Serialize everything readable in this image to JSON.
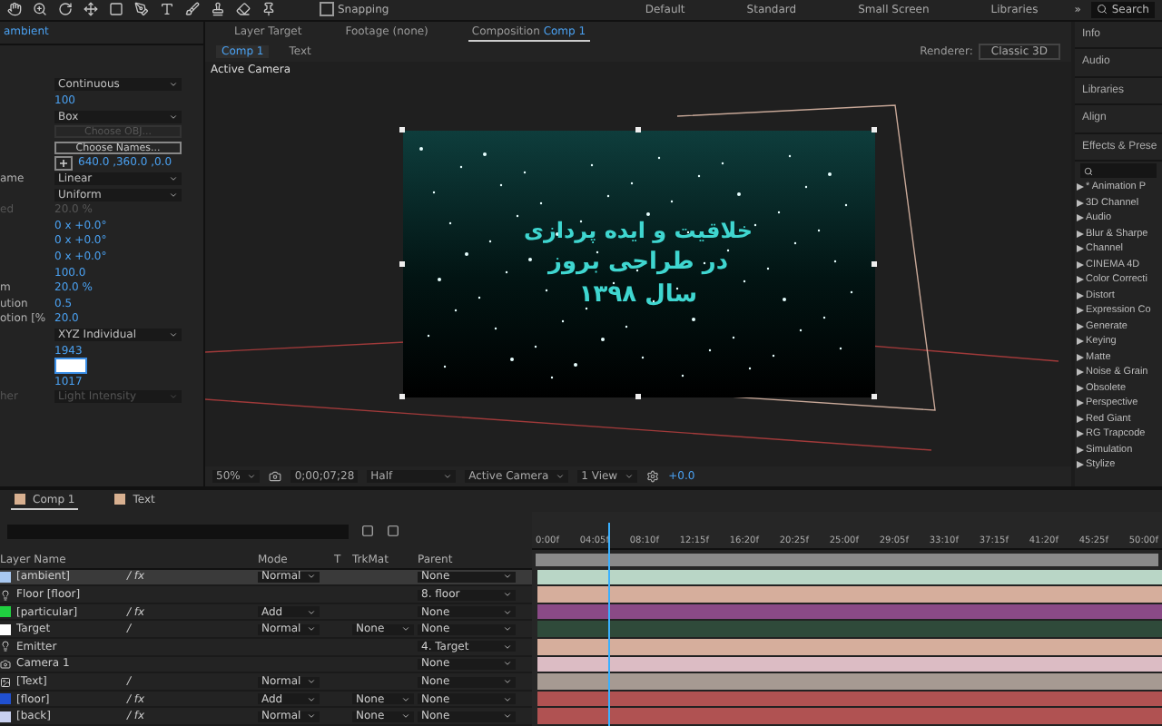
{
  "toolbar": {
    "snapping": {
      "label": "Snapping",
      "checked": false
    },
    "workspaces": [
      {
        "label": "Default",
        "selected": false
      },
      {
        "label": "Standard",
        "selected": false
      },
      {
        "label": "Small Screen",
        "selected": false
      },
      {
        "label": "Libraries",
        "selected": false
      }
    ],
    "more": "»",
    "search": {
      "placeholder": "Search"
    }
  },
  "effect_controls": {
    "tab": "ambient",
    "properties": [
      {
        "kind": "dropdown",
        "value": "Continuous",
        "disabled": false
      },
      {
        "kind": "number",
        "value": "100",
        "disabled": false
      },
      {
        "kind": "dropdown",
        "value": "Box",
        "disabled": false
      },
      {
        "kind": "button",
        "value": "Choose OBJ...",
        "disabled": true
      },
      {
        "kind": "button",
        "value": "Choose Names...",
        "disabled": false
      },
      {
        "kind": "point",
        "value": "640.0 ,360.0 ,0.0",
        "disabled": false
      },
      {
        "kind": "dropdown",
        "label": "ame",
        "value": "Linear",
        "disabled": false
      },
      {
        "kind": "dropdown",
        "value": "Uniform",
        "disabled": false
      },
      {
        "kind": "number",
        "label": "ed",
        "value": "20.0 %",
        "disabled": true
      },
      {
        "kind": "number",
        "value": "0 x +0.0°",
        "disabled": false
      },
      {
        "kind": "number",
        "value": "0 x +0.0°",
        "disabled": false
      },
      {
        "kind": "number",
        "value": "0 x +0.0°",
        "disabled": false
      },
      {
        "kind": "number",
        "value": "100.0",
        "disabled": false
      },
      {
        "kind": "number",
        "label": "m",
        "value": "20.0 %",
        "disabled": false
      },
      {
        "kind": "number",
        "label": "ution",
        "value": "0.5",
        "disabled": false
      },
      {
        "kind": "number",
        "label": "otion [%",
        "value": "20.0",
        "disabled": false
      },
      {
        "kind": "dropdown",
        "value": "XYZ Individual",
        "disabled": false
      },
      {
        "kind": "number",
        "value": "1943",
        "disabled": false
      },
      {
        "kind": "editing",
        "disabled": false
      },
      {
        "kind": "number",
        "value": "1017",
        "disabled": false
      },
      {
        "kind": "dropdown",
        "label": "her",
        "value": "Light Intensity",
        "disabled": true
      }
    ]
  },
  "viewer": {
    "tabs": [
      {
        "label": "Layer",
        "name": "Target",
        "selected": false
      },
      {
        "label": "Footage",
        "name": "(none)",
        "selected": false
      },
      {
        "label": "Composition",
        "name": "Comp 1",
        "selected": true
      }
    ],
    "subtabs": [
      {
        "label": "Comp 1",
        "selected": true
      },
      {
        "label": "Text",
        "selected": false
      }
    ],
    "renderer": {
      "label": "Renderer:",
      "value": "Classic 3D"
    },
    "view_label": "Active Camera",
    "comp_text": [
      "خلاقیت و ایده پردازی",
      "در طراحی بروز",
      "سال ۱۳۹۸"
    ],
    "bottom_bar": {
      "zoom": "50%",
      "timecode": "0;00;07;28",
      "resolution": "Half",
      "camera": "Active Camera",
      "layout": "1 View",
      "exposure": "+0.0"
    }
  },
  "right_panel": {
    "panels": [
      "Info",
      "Audio",
      "Libraries",
      "Align",
      "Effects & Prese"
    ],
    "effects": [
      "* Animation P",
      "3D Channel",
      "Audio",
      "Blur & Sharpe",
      "Channel",
      "CINEMA 4D",
      "Color Correcti",
      "Distort",
      "Expression Co",
      "Generate",
      "Keying",
      "Matte",
      "Noise & Grain",
      "Obsolete",
      "Perspective",
      "Red Giant",
      "RG Trapcode",
      "Simulation",
      "Stylize"
    ]
  },
  "timeline": {
    "tabs": [
      {
        "label": "Comp 1",
        "selected": true
      },
      {
        "label": "Text",
        "selected": false
      }
    ],
    "columns": {
      "name": "Layer Name",
      "mode": "Mode",
      "t": "T",
      "trkmat": "TrkMat",
      "parent": "Parent"
    },
    "ticks": [
      "0:00f",
      "04:05f",
      "08:10f",
      "12:15f",
      "16:20f",
      "20:25f",
      "25:00f",
      "29:05f",
      "33:10f",
      "37:15f",
      "41:20f",
      "45:25f",
      "50:00f"
    ],
    "playhead": {
      "level": 0.12
    },
    "bars": [
      {
        "color": "#b9d6c6"
      },
      {
        "color": "#d6ae9c"
      },
      {
        "color": "#8a4a86"
      },
      {
        "color": "#2f4a3a"
      },
      {
        "color": "#d6ae9c"
      },
      {
        "color": "#dcbcc4"
      },
      {
        "color": "#a69a92"
      },
      {
        "color": "#b05252"
      },
      {
        "color": "#b05252"
      }
    ],
    "layers": [
      {
        "kind": "solid",
        "color": "#a8c8f0",
        "name": "[ambient]",
        "switches": "/ fx",
        "mode": "Normal",
        "parent": "None",
        "selected": true
      },
      {
        "kind": "light",
        "name": "Floor [floor]",
        "parent": "8. floor",
        "selected": false
      },
      {
        "kind": "solid",
        "color": "#20d040",
        "name": "[particular]",
        "switches": "/ fx",
        "mode": "Add",
        "parent": "None",
        "selected": false
      },
      {
        "kind": "solid",
        "color": "#ffffff",
        "name": "Target",
        "switches": "/",
        "mode": "Normal",
        "trkmat": "None",
        "parent": "None",
        "selected": false
      },
      {
        "kind": "light",
        "name": "Emitter",
        "parent": "4. Target",
        "selected": false
      },
      {
        "kind": "camera",
        "name": "Camera 1",
        "parent": "None",
        "selected": false
      },
      {
        "kind": "footage",
        "name": "[Text]",
        "switches": "/",
        "mode": "Normal",
        "parent": "None",
        "selected": false
      },
      {
        "kind": "solid",
        "color": "#2050d0",
        "name": "[floor]",
        "switches": "/ fx",
        "mode": "Add",
        "trkmat": "None",
        "parent": "None",
        "selected": false
      },
      {
        "kind": "solid",
        "color": "#c8d0f0",
        "name": "[back]",
        "switches": "/ fx",
        "mode": "Normal",
        "trkmat": "None",
        "parent": "None",
        "selected": false
      }
    ]
  }
}
